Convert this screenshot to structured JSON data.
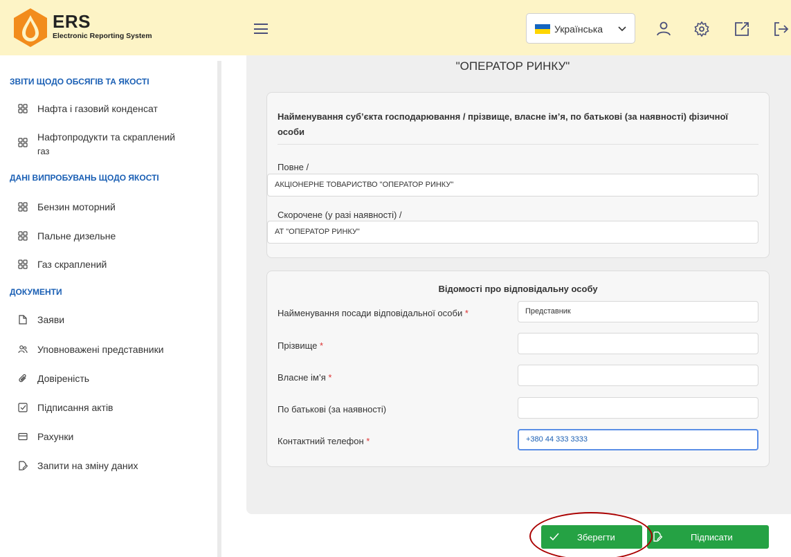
{
  "header": {
    "logo_title": "ERS",
    "logo_subtitle": "Electronic Reporting System",
    "language": "Українська"
  },
  "sidebar": {
    "sections": [
      {
        "title": "ЗВІТИ ЩОДО ОБСЯГІВ ТА ЯКОСТІ"
      },
      {
        "title": "ДАНІ ВИПРОБУВАНЬ ЩОДО ЯКОСТІ"
      },
      {
        "title": "ДОКУМЕНТИ"
      }
    ],
    "items": [
      {
        "label": "Нафта і газовий конденсат",
        "icon": "grid-icon"
      },
      {
        "label_line1": "Нафтопродукти та скраплений",
        "label_line2": "газ",
        "icon": "grid-icon"
      },
      {
        "label": "Бензин моторний",
        "icon": "grid-icon"
      },
      {
        "label": "Пальне дизельне",
        "icon": "grid-icon"
      },
      {
        "label": "Газ скраплений",
        "icon": "grid-icon"
      },
      {
        "label": "Заяви",
        "icon": "file-icon"
      },
      {
        "label": "Уповноважені представники",
        "icon": "users-icon"
      },
      {
        "label": "Довіреність",
        "icon": "paperclip-icon"
      },
      {
        "label": "Підписання актів",
        "icon": "checkbox-icon"
      },
      {
        "label": "Рахунки",
        "icon": "card-icon"
      },
      {
        "label": "Запити на зміну даних",
        "icon": "edit-file-icon"
      }
    ]
  },
  "main": {
    "title": "\"ОПЕРАТОР РИНКУ\"",
    "entity_card": {
      "title": "Найменування суб’єкта господарювання / прізвище, власне ім’я, по батькові (за наявності) фізичної особи",
      "full_label": "Повне /",
      "full_value": "АКЦІОНЕРНЕ ТОВАРИСТВО \"ОПЕРАТОР РИНКУ\"",
      "short_label": "Скорочене (у разі наявності) /",
      "short_value": "АТ \"ОПЕРАТОР РИНКУ\""
    },
    "person_card": {
      "title": "Відомості про відповідальну особу",
      "position_label": "Найменування посади відповідальної особи",
      "position_value": "Представник",
      "surname_label": "Прізвище",
      "surname_value": "",
      "name_label": "Власне ім’я",
      "name_value": "",
      "patronymic_label": "По батькові (за наявності)",
      "patronymic_value": "",
      "phone_label": "Контактний телефон",
      "phone_value": "+380 44 333 3333",
      "required_mark": "*"
    }
  },
  "buttons": {
    "save": "Зберегти",
    "sign": "Підписати"
  },
  "colors": {
    "header_bg": "#fdf4c6",
    "accent_blue": "#1a5fb4",
    "button_green": "#25a244",
    "logo_orange": "#f28c1c"
  }
}
